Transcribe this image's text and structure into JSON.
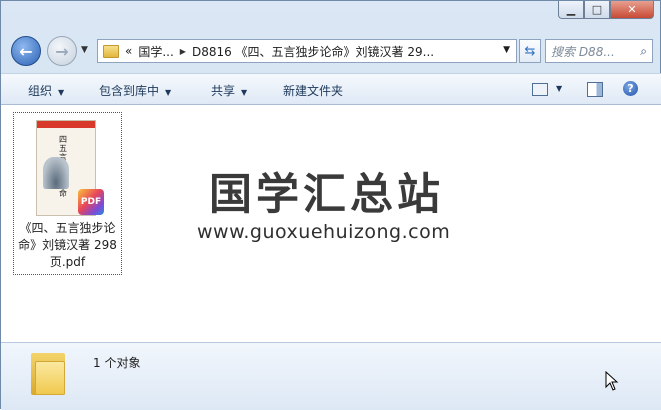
{
  "window": {
    "controls": {
      "minimize": "▁",
      "maximize": "□",
      "close": "✕"
    }
  },
  "nav": {
    "back_icon": "arrow-left-icon",
    "forward_icon": "arrow-right-icon",
    "address": {
      "overflow": "«",
      "crumb1": "国学...",
      "crumb2": "D8816 《四、五言独步论命》刘镜汉著 29..."
    },
    "search_placeholder": "搜索 D88..."
  },
  "toolbar": {
    "organize": "组织",
    "include_library": "包含到库中",
    "share": "共享",
    "new_folder": "新建文件夹"
  },
  "file": {
    "name": "《四、五言独步论命》刘镜汉著 298页.pdf",
    "thumb_title": "四五言独步论命",
    "thumb_tag": "PDF",
    "badge": "PDF"
  },
  "watermark": {
    "title": "国学汇总站",
    "url": "www.guoxuehuizong.com"
  },
  "details": {
    "count": "1 个对象"
  }
}
